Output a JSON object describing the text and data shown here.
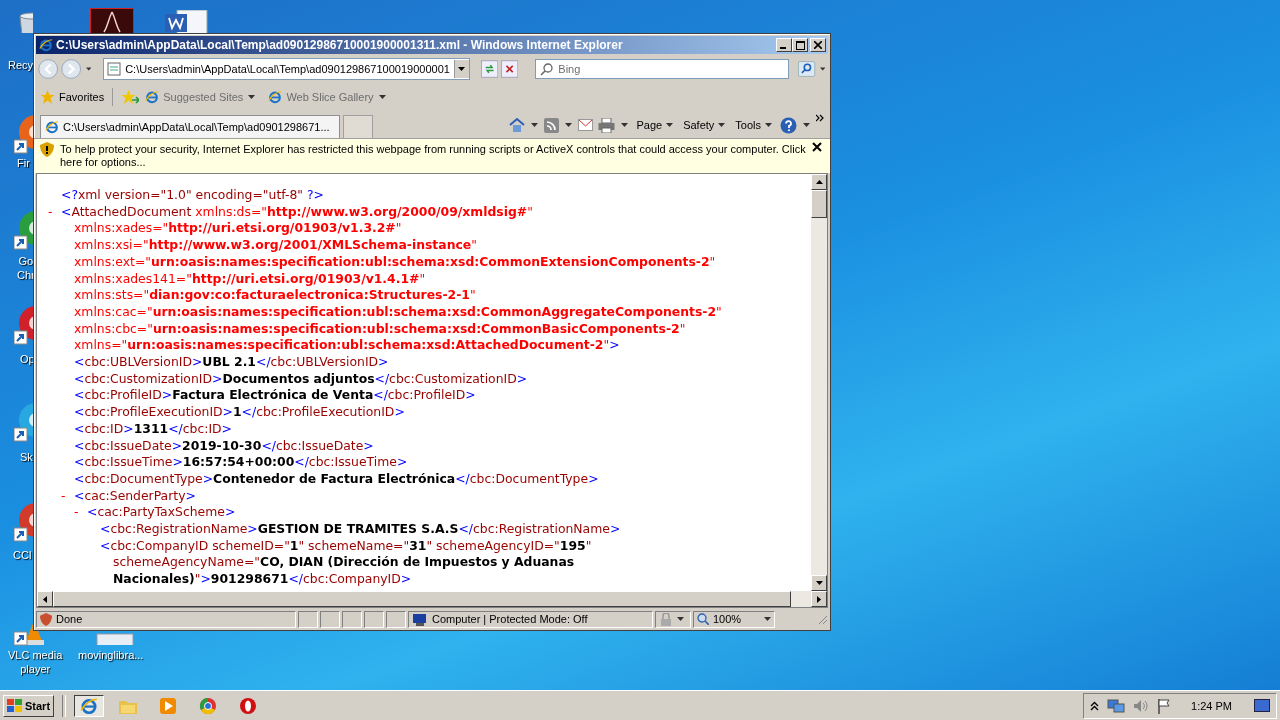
{
  "desktop_icons": [
    {
      "kind": "bin",
      "label_lines": [
        "Recy"
      ]
    },
    {
      "kind": "fox",
      "label_lines": [
        "Fir"
      ]
    },
    {
      "kind": "wheel",
      "label_lines": [
        "Go",
        "Chr"
      ]
    },
    {
      "kind": "ring",
      "label_lines": [
        "Op"
      ]
    },
    {
      "kind": "cloud",
      "label_lines": [
        "Sk"
      ]
    },
    {
      "kind": "broom",
      "label_lines": [
        "CCl"
      ]
    },
    {
      "kind": "cone",
      "label_lines": [
        "VLC media",
        "player"
      ]
    },
    {
      "kind": "sheet",
      "label_lines": [
        "movinglibra..."
      ]
    }
  ],
  "window": {
    "title": "C:\\Users\\admin\\AppData\\Local\\Temp\\ad09012986710001900001311.xml - Windows Internet Explorer",
    "address": "C:\\Users\\admin\\AppData\\Local\\Temp\\ad090129867100019000001",
    "search": {
      "placeholder": "Bing"
    },
    "favorites_bar": {
      "favorites": "Favorites",
      "links": [
        {
          "label": "Suggested Sites"
        },
        {
          "label": "Web Slice Gallery"
        }
      ]
    },
    "tab": {
      "title": "C:\\Users\\admin\\AppData\\Local\\Temp\\ad0901298671..."
    },
    "command_bar": [
      {
        "label": "Page"
      },
      {
        "label": "Safety"
      },
      {
        "label": "Tools"
      }
    ],
    "info_bar": "To help protect your security, Internet Explorer has restricted this webpage from running scripts or ActiveX controls that could access your computer. Click here for options...",
    "xml": {
      "declaration": [
        {
          "kind": "punct",
          "text": "<?"
        },
        {
          "kind": "tag",
          "text": "xml version=\"1.0\" encoding=\"utf-8\" "
        },
        {
          "kind": "punct",
          "text": "?>"
        }
      ],
      "nodes": [
        {
          "toggle": "-",
          "lines": [
            [
              {
                "kind": "punct",
                "text": "<"
              },
              {
                "kind": "tag",
                "text": "AttachedDocument"
              },
              {
                "kind": "nsattr",
                "text": " xmlns:ds=\""
              },
              {
                "kind": "nsval",
                "text": "http://www.w3.org/2000/09/xmldsig#"
              },
              {
                "kind": "nsattr",
                "text": "\""
              }
            ],
            [
              {
                "kind": "nsattr",
                "text": "xmlns:xades=\""
              },
              {
                "kind": "nsval",
                "text": "http://uri.etsi.org/01903/v1.3.2#"
              },
              {
                "kind": "nsattr",
                "text": "\""
              }
            ],
            [
              {
                "kind": "nsattr",
                "text": "xmlns:xsi=\""
              },
              {
                "kind": "nsval",
                "text": "http://www.w3.org/2001/XMLSchema-instance"
              },
              {
                "kind": "nsattr",
                "text": "\""
              }
            ],
            [
              {
                "kind": "nsattr",
                "text": "xmlns:ext=\""
              },
              {
                "kind": "nsval",
                "text": "urn:oasis:names:specification:ubl:schema:xsd:CommonExtensionComponents-2"
              },
              {
                "kind": "nsattr",
                "text": "\""
              }
            ],
            [
              {
                "kind": "nsattr",
                "text": "xmlns:xades141=\""
              },
              {
                "kind": "nsval",
                "text": "http://uri.etsi.org/01903/v1.4.1#"
              },
              {
                "kind": "nsattr",
                "text": "\""
              }
            ],
            [
              {
                "kind": "nsattr",
                "text": "xmlns:sts=\""
              },
              {
                "kind": "nsval",
                "text": "dian:gov:co:facturaelectronica:Structures-2-1"
              },
              {
                "kind": "nsattr",
                "text": "\""
              }
            ],
            [
              {
                "kind": "nsattr",
                "text": "xmlns:cac=\""
              },
              {
                "kind": "nsval",
                "text": "urn:oasis:names:specification:ubl:schema:xsd:CommonAggregateComponents-2"
              },
              {
                "kind": "nsattr",
                "text": "\""
              }
            ],
            [
              {
                "kind": "nsattr",
                "text": "xmlns:cbc=\""
              },
              {
                "kind": "nsval",
                "text": "urn:oasis:names:specification:ubl:schema:xsd:CommonBasicComponents-2"
              },
              {
                "kind": "nsattr",
                "text": "\""
              }
            ],
            [
              {
                "kind": "nsattr",
                "text": "xmlns=\""
              },
              {
                "kind": "nsval",
                "text": "urn:oasis:names:specification:ubl:schema:xsd:AttachedDocument-2"
              },
              {
                "kind": "nsattr",
                "text": "\""
              },
              {
                "kind": "punct",
                "text": ">"
              }
            ]
          ],
          "children": [
            {
              "lines": [
                [
                  {
                    "kind": "punct",
                    "text": "<"
                  },
                  {
                    "kind": "tag",
                    "text": "cbc:UBLVersionID"
                  },
                  {
                    "kind": "punct",
                    "text": ">"
                  },
                  {
                    "kind": "text",
                    "text": "UBL 2.1"
                  },
                  {
                    "kind": "punct",
                    "text": "</"
                  },
                  {
                    "kind": "tag",
                    "text": "cbc:UBLVersionID"
                  },
                  {
                    "kind": "punct",
                    "text": ">"
                  }
                ]
              ]
            },
            {
              "lines": [
                [
                  {
                    "kind": "punct",
                    "text": "<"
                  },
                  {
                    "kind": "tag",
                    "text": "cbc:CustomizationID"
                  },
                  {
                    "kind": "punct",
                    "text": ">"
                  },
                  {
                    "kind": "text",
                    "text": "Documentos adjuntos"
                  },
                  {
                    "kind": "punct",
                    "text": "</"
                  },
                  {
                    "kind": "tag",
                    "text": "cbc:CustomizationID"
                  },
                  {
                    "kind": "punct",
                    "text": ">"
                  }
                ]
              ]
            },
            {
              "lines": [
                [
                  {
                    "kind": "punct",
                    "text": "<"
                  },
                  {
                    "kind": "tag",
                    "text": "cbc:ProfileID"
                  },
                  {
                    "kind": "punct",
                    "text": ">"
                  },
                  {
                    "kind": "text",
                    "text": "Factura Electrónica de Venta"
                  },
                  {
                    "kind": "punct",
                    "text": "</"
                  },
                  {
                    "kind": "tag",
                    "text": "cbc:ProfileID"
                  },
                  {
                    "kind": "punct",
                    "text": ">"
                  }
                ]
              ]
            },
            {
              "lines": [
                [
                  {
                    "kind": "punct",
                    "text": "<"
                  },
                  {
                    "kind": "tag",
                    "text": "cbc:ProfileExecutionID"
                  },
                  {
                    "kind": "punct",
                    "text": ">"
                  },
                  {
                    "kind": "text",
                    "text": "1"
                  },
                  {
                    "kind": "punct",
                    "text": "</"
                  },
                  {
                    "kind": "tag",
                    "text": "cbc:ProfileExecutionID"
                  },
                  {
                    "kind": "punct",
                    "text": ">"
                  }
                ]
              ]
            },
            {
              "lines": [
                [
                  {
                    "kind": "punct",
                    "text": "<"
                  },
                  {
                    "kind": "tag",
                    "text": "cbc:ID"
                  },
                  {
                    "kind": "punct",
                    "text": ">"
                  },
                  {
                    "kind": "text",
                    "text": "1311"
                  },
                  {
                    "kind": "punct",
                    "text": "</"
                  },
                  {
                    "kind": "tag",
                    "text": "cbc:ID"
                  },
                  {
                    "kind": "punct",
                    "text": ">"
                  }
                ]
              ]
            },
            {
              "lines": [
                [
                  {
                    "kind": "punct",
                    "text": "<"
                  },
                  {
                    "kind": "tag",
                    "text": "cbc:IssueDate"
                  },
                  {
                    "kind": "punct",
                    "text": ">"
                  },
                  {
                    "kind": "text",
                    "text": "2019-10-30"
                  },
                  {
                    "kind": "punct",
                    "text": "</"
                  },
                  {
                    "kind": "tag",
                    "text": "cbc:IssueDate"
                  },
                  {
                    "kind": "punct",
                    "text": ">"
                  }
                ]
              ]
            },
            {
              "lines": [
                [
                  {
                    "kind": "punct",
                    "text": "<"
                  },
                  {
                    "kind": "tag",
                    "text": "cbc:IssueTime"
                  },
                  {
                    "kind": "punct",
                    "text": ">"
                  },
                  {
                    "kind": "text",
                    "text": "16:57:54+00:00"
                  },
                  {
                    "kind": "punct",
                    "text": "</"
                  },
                  {
                    "kind": "tag",
                    "text": "cbc:IssueTime"
                  },
                  {
                    "kind": "punct",
                    "text": ">"
                  }
                ]
              ]
            },
            {
              "lines": [
                [
                  {
                    "kind": "punct",
                    "text": "<"
                  },
                  {
                    "kind": "tag",
                    "text": "cbc:DocumentType"
                  },
                  {
                    "kind": "punct",
                    "text": ">"
                  },
                  {
                    "kind": "text",
                    "text": "Contenedor de Factura Electrónica"
                  },
                  {
                    "kind": "punct",
                    "text": "</"
                  },
                  {
                    "kind": "tag",
                    "text": "cbc:DocumentType"
                  },
                  {
                    "kind": "punct",
                    "text": ">"
                  }
                ]
              ]
            },
            {
              "toggle": "-",
              "lines": [
                [
                  {
                    "kind": "punct",
                    "text": "<"
                  },
                  {
                    "kind": "tag",
                    "text": "cac:SenderParty"
                  },
                  {
                    "kind": "punct",
                    "text": ">"
                  }
                ]
              ],
              "children": [
                {
                  "toggle": "-",
                  "lines": [
                    [
                      {
                        "kind": "punct",
                        "text": "<"
                      },
                      {
                        "kind": "tag",
                        "text": "cac:PartyTaxScheme"
                      },
                      {
                        "kind": "punct",
                        "text": ">"
                      }
                    ]
                  ],
                  "children": [
                    {
                      "lines": [
                        [
                          {
                            "kind": "punct",
                            "text": "<"
                          },
                          {
                            "kind": "tag",
                            "text": "cbc:RegistrationName"
                          },
                          {
                            "kind": "punct",
                            "text": ">"
                          },
                          {
                            "kind": "text",
                            "text": "GESTION DE TRAMITES S.A.S"
                          },
                          {
                            "kind": "punct",
                            "text": "</"
                          },
                          {
                            "kind": "tag",
                            "text": "cbc:RegistrationName"
                          },
                          {
                            "kind": "punct",
                            "text": ">"
                          }
                        ]
                      ]
                    },
                    {
                      "lines": [
                        [
                          {
                            "kind": "punct",
                            "text": "<"
                          },
                          {
                            "kind": "tag",
                            "text": "cbc:CompanyID"
                          },
                          {
                            "kind": "attr",
                            "text": " schemeID=\""
                          },
                          {
                            "kind": "val",
                            "text": "1"
                          },
                          {
                            "kind": "attr",
                            "text": "\" schemeName=\""
                          },
                          {
                            "kind": "val",
                            "text": "31"
                          },
                          {
                            "kind": "attr",
                            "text": "\" schemeAgencyID=\""
                          },
                          {
                            "kind": "val",
                            "text": "195"
                          },
                          {
                            "kind": "attr",
                            "text": "\""
                          }
                        ],
                        [
                          {
                            "kind": "attr",
                            "text": "schemeAgencyName=\""
                          },
                          {
                            "kind": "val",
                            "text": "CO, DIAN (Dirección de Impuestos y Aduanas"
                          }
                        ],
                        [
                          {
                            "kind": "val",
                            "text": "Nacionales)"
                          },
                          {
                            "kind": "attr",
                            "text": "\""
                          },
                          {
                            "kind": "punct",
                            "text": ">"
                          },
                          {
                            "kind": "text",
                            "text": "901298671"
                          },
                          {
                            "kind": "punct",
                            "text": "</"
                          },
                          {
                            "kind": "tag",
                            "text": "cbc:CompanyID"
                          },
                          {
                            "kind": "punct",
                            "text": ">"
                          }
                        ]
                      ]
                    }
                  ]
                }
              ]
            }
          ]
        }
      ]
    },
    "status_bar": {
      "status": "Done",
      "zone": "Computer | Protected Mode: Off",
      "zoom": "100%"
    }
  },
  "taskbar": {
    "start": "Start",
    "clock": "1:24 PM"
  }
}
